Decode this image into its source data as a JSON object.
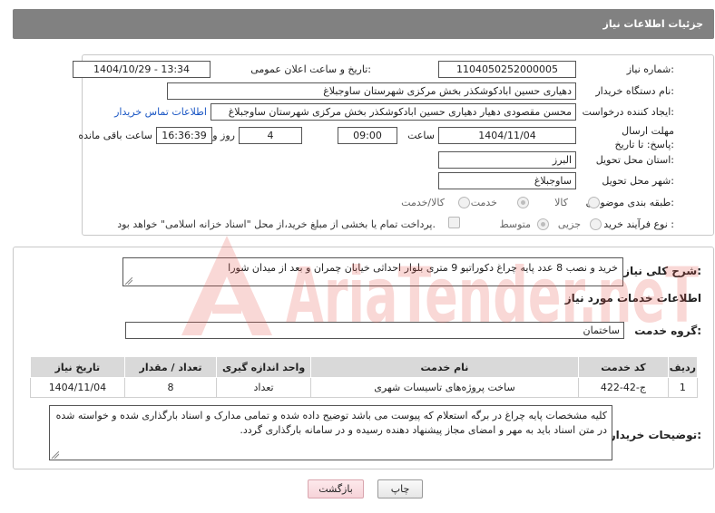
{
  "header": {
    "title": "جزئیات اطلاعات نیاز"
  },
  "form": {
    "need_number": {
      "label": "شماره نیاز:",
      "value": "1104050252000005"
    },
    "announce_datetime": {
      "label": "تاریخ و ساعت اعلان عمومی:",
      "value": "1404/10/29 - 13:34"
    },
    "buyer_org": {
      "label": "نام دستگاه خریدار:",
      "value": "دهیاری حسین ابادکوشکذر بخش مرکزی شهرستان ساوجبلاغ"
    },
    "requester": {
      "label": "ایجاد کننده درخواست:",
      "value": "محسن مقصودی دهیار دهیاری حسین ابادکوشکذر بخش مرکزی شهرستان ساوجبلاغ",
      "contact_link": "اطلاعات تماس خریدار"
    },
    "deadline": {
      "label": "مهلت ارسال پاسخ: تا تاریخ:",
      "date": "1404/11/04",
      "time_label": "ساعت",
      "time": "09:00",
      "days": "4",
      "days_label": "روز و",
      "remaining": "16:36:39",
      "remaining_label": "ساعت باقی مانده"
    },
    "province": {
      "label": "استان محل تحویل:",
      "value": "البرز"
    },
    "city": {
      "label": "شهر محل تحویل:",
      "value": "ساوجبلاغ"
    },
    "category": {
      "label": "طبقه بندی موضوعی:",
      "options": [
        "کالا",
        "خدمت",
        "کالا/خدمت"
      ],
      "selected": "خدمت"
    },
    "purchase_type": {
      "label": "نوع فرآیند خرید :",
      "options": [
        "جزیی",
        "متوسط"
      ],
      "selected": "متوسط",
      "note": "پرداخت تمام یا بخشی از مبلغ خرید،از محل \"اسناد خزانه اسلامی\" خواهد بود."
    }
  },
  "summary": {
    "label": "شرح کلی نیاز:",
    "value": "خرید و نصب 8 عدد پایه چراغ دکوراتیو 9 متری بلوار احداثی خیابان چمران و بعد از میدان شورا"
  },
  "services": {
    "section_title": "اطلاعات خدمات مورد نیاز",
    "group_label": "گروه خدمت:",
    "group_value": "ساختمان",
    "columns": [
      "ردیف",
      "کد خدمت",
      "نام خدمت",
      "واحد اندازه گیری",
      "تعداد / مقدار",
      "تاریخ نیاز"
    ],
    "rows": [
      [
        "1",
        "ج-42-422",
        "ساخت پروژه‌های تاسیسات شهری",
        "تعداد",
        "8",
        "1404/11/04"
      ]
    ]
  },
  "buyer_notes": {
    "label": "توضیحات خریدار:",
    "value": "کلیه مشخصات پایه چراغ در برگه استعلام که پیوست می باشد توضیح داده شده و تمامی مدارک و اسناد بارگذاری شده و خواسته شده در متن اسناد باید به مهر و امضای مجاز پیشنهاد دهنده رسیده و در سامانه بارگذاری گردد."
  },
  "buttons": {
    "print": "چاپ",
    "back": "بازگشت"
  },
  "watermark": {
    "brand": "AriaTender.neT"
  },
  "colors": {
    "header_bg": "#818181",
    "link": "#1a56c4",
    "table_header": "#d9d9d9",
    "watermark": "#e8524a"
  }
}
